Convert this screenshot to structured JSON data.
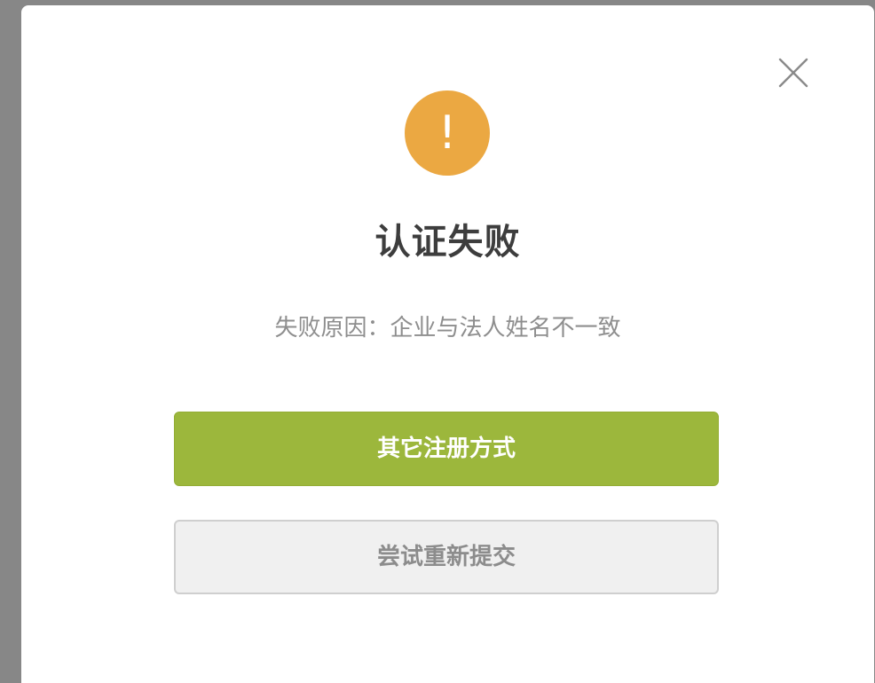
{
  "dialog": {
    "close_icon": "close-icon",
    "status_icon": "warning-icon",
    "status_glyph": "!",
    "title": "认证失败",
    "reason": "失败原因：企业与法人姓名不一致",
    "primary_button": "其它注册方式",
    "secondary_button": "尝试重新提交"
  },
  "colors": {
    "warning": "#EBA842",
    "primary": "#9CB73C",
    "secondary_bg": "#F0F0F0",
    "overlay": "#878787"
  }
}
